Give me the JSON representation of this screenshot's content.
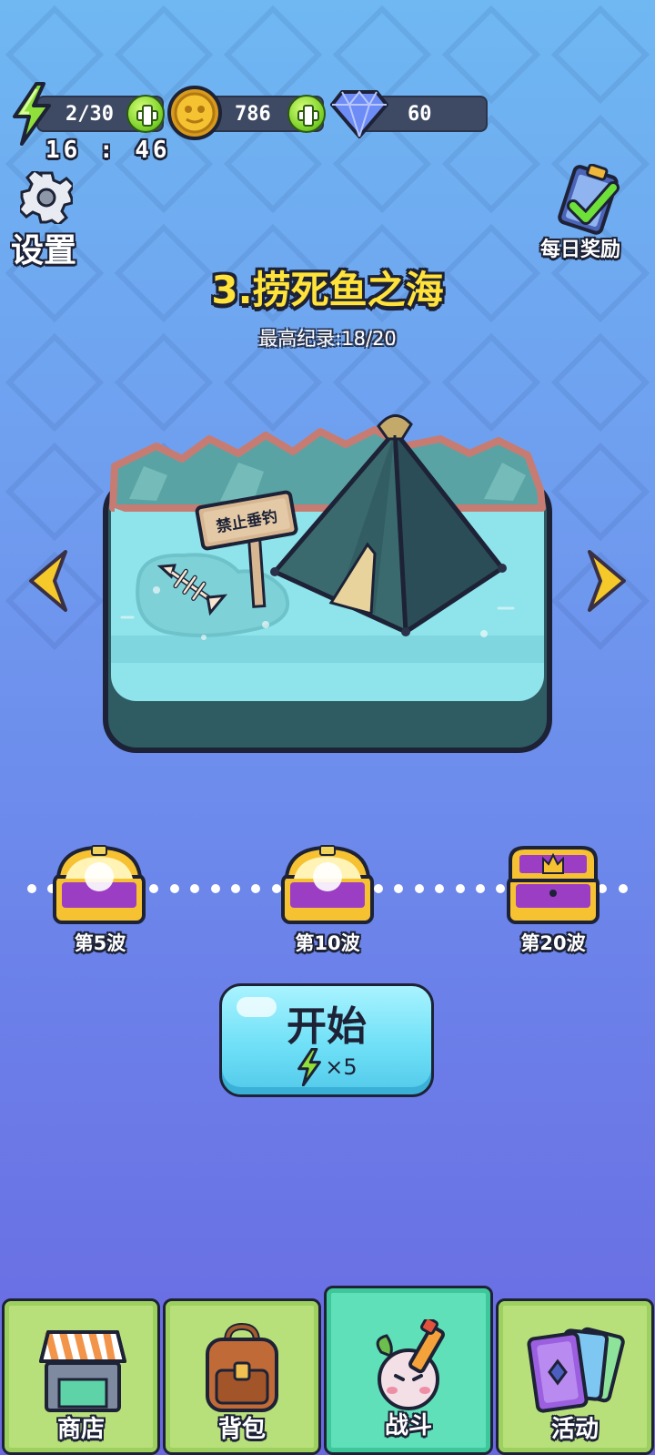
{
  "resources": {
    "energy": "2/30",
    "coins": "786",
    "gems": "60"
  },
  "timer": "16 : 46",
  "settings": {
    "label": "设置"
  },
  "daily_reward": {
    "label": "每日奖励"
  },
  "level": {
    "title": "3.捞死鱼之海",
    "record": "最高纪录:18/20",
    "sign_text": "禁止垂钓"
  },
  "rewards": [
    {
      "label": "第5波",
      "style": "open"
    },
    {
      "label": "第10波",
      "style": "open"
    },
    {
      "label": "第20波",
      "style": "closed"
    }
  ],
  "start": {
    "label": "开始",
    "cost": "×5"
  },
  "nav": [
    {
      "label": "商店",
      "icon": "shop-icon"
    },
    {
      "label": "背包",
      "icon": "backpack-icon"
    },
    {
      "label": "战斗",
      "icon": "battle-icon",
      "active": true
    },
    {
      "label": "活动",
      "icon": "cards-icon"
    }
  ],
  "colors": {
    "title_yellow": "#ffe33a",
    "start_button": "#6fe0f7",
    "nav_tab": "#b8e07a",
    "nav_active": "#5fe0b8"
  }
}
